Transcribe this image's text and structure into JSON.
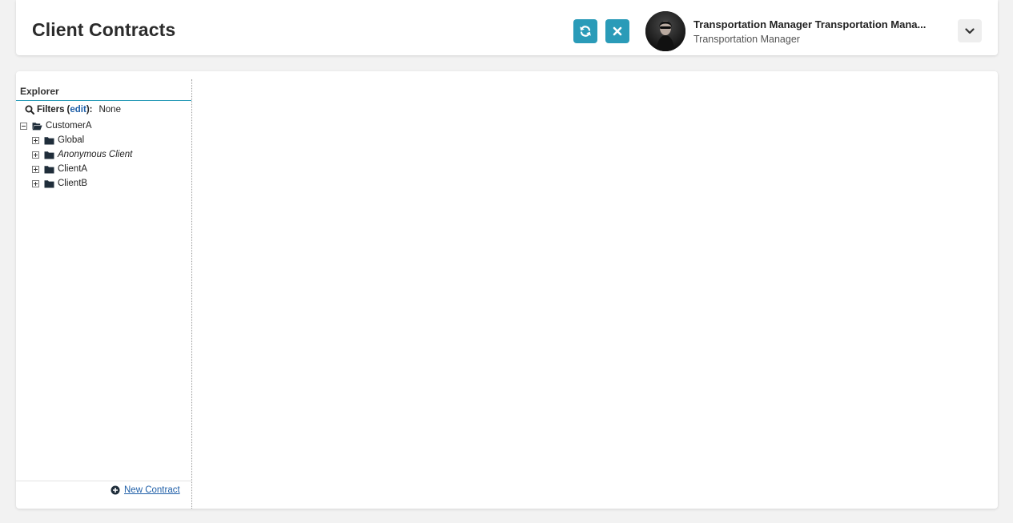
{
  "header": {
    "title": "Client Contracts",
    "refresh_icon": "refresh-icon",
    "close_icon": "close-icon",
    "user": {
      "name": "Transportation Manager Transportation Mana...",
      "role": "Transportation Manager"
    },
    "dropdown_icon": "chevron-down-icon",
    "accent_color": "#2a9bb8"
  },
  "explorer": {
    "title": "Explorer",
    "filters": {
      "label": "Filters",
      "open_paren": "(",
      "edit_label": "edit",
      "close_paren": "):",
      "value": "None"
    },
    "tree": {
      "root": {
        "label": "CustomerA",
        "expanded": true,
        "icon": "folder-open-icon"
      },
      "children": [
        {
          "label": "Global",
          "italic": false,
          "icon": "folder-icon"
        },
        {
          "label": "Anonymous Client",
          "italic": true,
          "icon": "folder-icon"
        },
        {
          "label": "ClientA",
          "italic": false,
          "icon": "folder-icon"
        },
        {
          "label": "ClientB",
          "italic": false,
          "icon": "folder-icon"
        }
      ]
    },
    "new_contract": {
      "label": "New Contract",
      "icon": "plus-circle-icon"
    }
  }
}
